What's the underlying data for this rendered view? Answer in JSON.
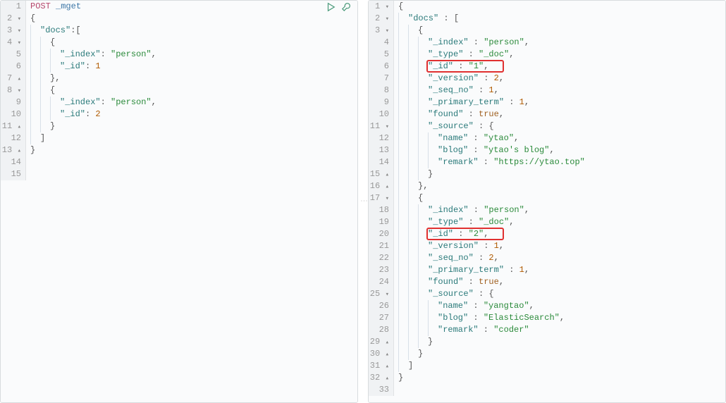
{
  "left": {
    "method": "POST",
    "endpoint": "_mget",
    "lines": [
      {
        "n": "1",
        "marker": "",
        "indent": 0,
        "tokens": [
          [
            "method",
            "POST"
          ],
          [
            "space",
            " "
          ],
          [
            "endpoint",
            "_mget"
          ]
        ]
      },
      {
        "n": "2",
        "marker": "▾",
        "indent": 0,
        "tokens": [
          [
            "punct",
            "{"
          ]
        ]
      },
      {
        "n": "3",
        "marker": "▾",
        "indent": 1,
        "tokens": [
          [
            "key",
            "\"docs\""
          ],
          [
            "punct",
            ":["
          ]
        ]
      },
      {
        "n": "4",
        "marker": "▾",
        "indent": 2,
        "tokens": [
          [
            "punct",
            "{"
          ]
        ]
      },
      {
        "n": "5",
        "marker": "",
        "indent": 3,
        "tokens": [
          [
            "key",
            "\"_index\""
          ],
          [
            "punct",
            ": "
          ],
          [
            "string",
            "\"person\""
          ],
          [
            "punct",
            ","
          ]
        ]
      },
      {
        "n": "6",
        "marker": "",
        "indent": 3,
        "tokens": [
          [
            "key",
            "\"_id\""
          ],
          [
            "punct",
            ": "
          ],
          [
            "number",
            "1"
          ]
        ]
      },
      {
        "n": "7",
        "marker": "▴",
        "indent": 2,
        "tokens": [
          [
            "punct",
            "},"
          ]
        ]
      },
      {
        "n": "8",
        "marker": "▾",
        "indent": 2,
        "tokens": [
          [
            "punct",
            "{"
          ]
        ]
      },
      {
        "n": "9",
        "marker": "",
        "indent": 3,
        "tokens": [
          [
            "key",
            "\"_index\""
          ],
          [
            "punct",
            ": "
          ],
          [
            "string",
            "\"person\""
          ],
          [
            "punct",
            ","
          ]
        ]
      },
      {
        "n": "10",
        "marker": "",
        "indent": 3,
        "tokens": [
          [
            "key",
            "\"_id\""
          ],
          [
            "punct",
            ": "
          ],
          [
            "number",
            "2"
          ]
        ]
      },
      {
        "n": "11",
        "marker": "▴",
        "indent": 2,
        "tokens": [
          [
            "punct",
            "}"
          ]
        ]
      },
      {
        "n": "12",
        "marker": "",
        "indent": 1,
        "tokens": [
          [
            "punct",
            "]"
          ]
        ]
      },
      {
        "n": "13",
        "marker": "▴",
        "indent": 0,
        "tokens": [
          [
            "punct",
            "}"
          ]
        ]
      },
      {
        "n": "14",
        "marker": "",
        "indent": 0,
        "tokens": []
      },
      {
        "n": "15",
        "marker": "",
        "indent": 0,
        "tokens": []
      }
    ]
  },
  "right": {
    "highlight_lines": [
      6,
      20
    ],
    "lines": [
      {
        "n": "1",
        "marker": "▾",
        "indent": 0,
        "tokens": [
          [
            "punct",
            "{"
          ]
        ]
      },
      {
        "n": "2",
        "marker": "▾",
        "indent": 1,
        "tokens": [
          [
            "key",
            "\"docs\""
          ],
          [
            "punct",
            " : ["
          ]
        ]
      },
      {
        "n": "3",
        "marker": "▾",
        "indent": 2,
        "tokens": [
          [
            "punct",
            "{"
          ]
        ]
      },
      {
        "n": "4",
        "marker": "",
        "indent": 3,
        "tokens": [
          [
            "key",
            "\"_index\""
          ],
          [
            "punct",
            " : "
          ],
          [
            "string",
            "\"person\""
          ],
          [
            "punct",
            ","
          ]
        ]
      },
      {
        "n": "5",
        "marker": "",
        "indent": 3,
        "tokens": [
          [
            "key",
            "\"_type\""
          ],
          [
            "punct",
            " : "
          ],
          [
            "string",
            "\"_doc\""
          ],
          [
            "punct",
            ","
          ]
        ]
      },
      {
        "n": "6",
        "marker": "",
        "indent": 3,
        "tokens": [
          [
            "key",
            "\"_id\""
          ],
          [
            "punct",
            " : "
          ],
          [
            "string",
            "\"1\""
          ],
          [
            "punct",
            ","
          ]
        ]
      },
      {
        "n": "7",
        "marker": "",
        "indent": 3,
        "tokens": [
          [
            "key",
            "\"_version\""
          ],
          [
            "punct",
            " : "
          ],
          [
            "number",
            "2"
          ],
          [
            "punct",
            ","
          ]
        ]
      },
      {
        "n": "8",
        "marker": "",
        "indent": 3,
        "tokens": [
          [
            "key",
            "\"_seq_no\""
          ],
          [
            "punct",
            " : "
          ],
          [
            "number",
            "1"
          ],
          [
            "punct",
            ","
          ]
        ]
      },
      {
        "n": "9",
        "marker": "",
        "indent": 3,
        "tokens": [
          [
            "key",
            "\"_primary_term\""
          ],
          [
            "punct",
            " : "
          ],
          [
            "number",
            "1"
          ],
          [
            "punct",
            ","
          ]
        ]
      },
      {
        "n": "10",
        "marker": "",
        "indent": 3,
        "tokens": [
          [
            "key",
            "\"found\""
          ],
          [
            "punct",
            " : "
          ],
          [
            "bool",
            "true"
          ],
          [
            "punct",
            ","
          ]
        ]
      },
      {
        "n": "11",
        "marker": "▾",
        "indent": 3,
        "tokens": [
          [
            "key",
            "\"_source\""
          ],
          [
            "punct",
            " : {"
          ]
        ]
      },
      {
        "n": "12",
        "marker": "",
        "indent": 4,
        "tokens": [
          [
            "key",
            "\"name\""
          ],
          [
            "punct",
            " : "
          ],
          [
            "string",
            "\"ytao\""
          ],
          [
            "punct",
            ","
          ]
        ]
      },
      {
        "n": "13",
        "marker": "",
        "indent": 4,
        "tokens": [
          [
            "key",
            "\"blog\""
          ],
          [
            "punct",
            " : "
          ],
          [
            "string",
            "\"ytao's blog\""
          ],
          [
            "punct",
            ","
          ]
        ]
      },
      {
        "n": "14",
        "marker": "",
        "indent": 4,
        "tokens": [
          [
            "key",
            "\"remark\""
          ],
          [
            "punct",
            " : "
          ],
          [
            "string",
            "\"https://ytao.top\""
          ]
        ]
      },
      {
        "n": "15",
        "marker": "▴",
        "indent": 3,
        "tokens": [
          [
            "punct",
            "}"
          ]
        ]
      },
      {
        "n": "16",
        "marker": "▴",
        "indent": 2,
        "tokens": [
          [
            "punct",
            "},"
          ]
        ]
      },
      {
        "n": "17",
        "marker": "▾",
        "indent": 2,
        "tokens": [
          [
            "punct",
            "{"
          ]
        ]
      },
      {
        "n": "18",
        "marker": "",
        "indent": 3,
        "tokens": [
          [
            "key",
            "\"_index\""
          ],
          [
            "punct",
            " : "
          ],
          [
            "string",
            "\"person\""
          ],
          [
            "punct",
            ","
          ]
        ]
      },
      {
        "n": "19",
        "marker": "",
        "indent": 3,
        "tokens": [
          [
            "key",
            "\"_type\""
          ],
          [
            "punct",
            " : "
          ],
          [
            "string",
            "\"_doc\""
          ],
          [
            "punct",
            ","
          ]
        ]
      },
      {
        "n": "20",
        "marker": "",
        "indent": 3,
        "tokens": [
          [
            "key",
            "\"_id\""
          ],
          [
            "punct",
            " : "
          ],
          [
            "string",
            "\"2\""
          ],
          [
            "punct",
            ","
          ]
        ]
      },
      {
        "n": "21",
        "marker": "",
        "indent": 3,
        "tokens": [
          [
            "key",
            "\"_version\""
          ],
          [
            "punct",
            " : "
          ],
          [
            "number",
            "1"
          ],
          [
            "punct",
            ","
          ]
        ]
      },
      {
        "n": "22",
        "marker": "",
        "indent": 3,
        "tokens": [
          [
            "key",
            "\"_seq_no\""
          ],
          [
            "punct",
            " : "
          ],
          [
            "number",
            "2"
          ],
          [
            "punct",
            ","
          ]
        ]
      },
      {
        "n": "23",
        "marker": "",
        "indent": 3,
        "tokens": [
          [
            "key",
            "\"_primary_term\""
          ],
          [
            "punct",
            " : "
          ],
          [
            "number",
            "1"
          ],
          [
            "punct",
            ","
          ]
        ]
      },
      {
        "n": "24",
        "marker": "",
        "indent": 3,
        "tokens": [
          [
            "key",
            "\"found\""
          ],
          [
            "punct",
            " : "
          ],
          [
            "bool",
            "true"
          ],
          [
            "punct",
            ","
          ]
        ]
      },
      {
        "n": "25",
        "marker": "▾",
        "indent": 3,
        "tokens": [
          [
            "key",
            "\"_source\""
          ],
          [
            "punct",
            " : {"
          ]
        ]
      },
      {
        "n": "26",
        "marker": "",
        "indent": 4,
        "tokens": [
          [
            "key",
            "\"name\""
          ],
          [
            "punct",
            " : "
          ],
          [
            "string",
            "\"yangtao\""
          ],
          [
            "punct",
            ","
          ]
        ]
      },
      {
        "n": "27",
        "marker": "",
        "indent": 4,
        "tokens": [
          [
            "key",
            "\"blog\""
          ],
          [
            "punct",
            " : "
          ],
          [
            "string",
            "\"ElasticSearch\""
          ],
          [
            "punct",
            ","
          ]
        ]
      },
      {
        "n": "28",
        "marker": "",
        "indent": 4,
        "tokens": [
          [
            "key",
            "\"remark\""
          ],
          [
            "punct",
            " : "
          ],
          [
            "string",
            "\"coder\""
          ]
        ]
      },
      {
        "n": "29",
        "marker": "▴",
        "indent": 3,
        "tokens": [
          [
            "punct",
            "}"
          ]
        ]
      },
      {
        "n": "30",
        "marker": "▴",
        "indent": 2,
        "tokens": [
          [
            "punct",
            "}"
          ]
        ]
      },
      {
        "n": "31",
        "marker": "▴",
        "indent": 1,
        "tokens": [
          [
            "punct",
            "]"
          ]
        ]
      },
      {
        "n": "32",
        "marker": "▴",
        "indent": 0,
        "tokens": [
          [
            "punct",
            "}"
          ]
        ]
      },
      {
        "n": "33",
        "marker": "",
        "indent": 0,
        "tokens": []
      }
    ]
  }
}
